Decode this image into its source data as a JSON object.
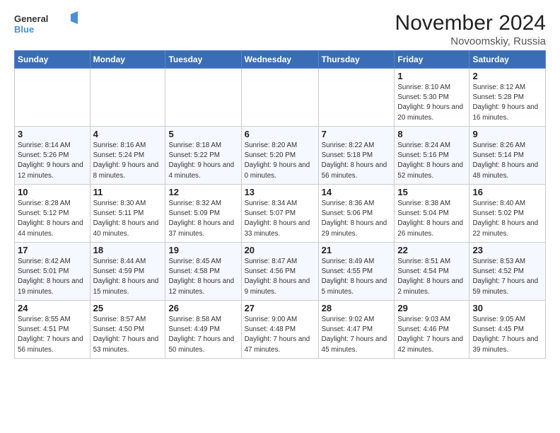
{
  "logo": {
    "text_general": "General",
    "text_blue": "Blue"
  },
  "header": {
    "title": "November 2024",
    "subtitle": "Novoomskiy, Russia"
  },
  "days_of_week": [
    "Sunday",
    "Monday",
    "Tuesday",
    "Wednesday",
    "Thursday",
    "Friday",
    "Saturday"
  ],
  "weeks": [
    [
      null,
      null,
      null,
      null,
      null,
      {
        "day": "1",
        "sunrise": "8:10 AM",
        "sunset": "5:30 PM",
        "daylight": "9 hours and 20 minutes."
      },
      {
        "day": "2",
        "sunrise": "8:12 AM",
        "sunset": "5:28 PM",
        "daylight": "9 hours and 16 minutes."
      }
    ],
    [
      {
        "day": "3",
        "sunrise": "8:14 AM",
        "sunset": "5:26 PM",
        "daylight": "9 hours and 12 minutes."
      },
      {
        "day": "4",
        "sunrise": "8:16 AM",
        "sunset": "5:24 PM",
        "daylight": "9 hours and 8 minutes."
      },
      {
        "day": "5",
        "sunrise": "8:18 AM",
        "sunset": "5:22 PM",
        "daylight": "9 hours and 4 minutes."
      },
      {
        "day": "6",
        "sunrise": "8:20 AM",
        "sunset": "5:20 PM",
        "daylight": "9 hours and 0 minutes."
      },
      {
        "day": "7",
        "sunrise": "8:22 AM",
        "sunset": "5:18 PM",
        "daylight": "8 hours and 56 minutes."
      },
      {
        "day": "8",
        "sunrise": "8:24 AM",
        "sunset": "5:16 PM",
        "daylight": "8 hours and 52 minutes."
      },
      {
        "day": "9",
        "sunrise": "8:26 AM",
        "sunset": "5:14 PM",
        "daylight": "8 hours and 48 minutes."
      }
    ],
    [
      {
        "day": "10",
        "sunrise": "8:28 AM",
        "sunset": "5:12 PM",
        "daylight": "8 hours and 44 minutes."
      },
      {
        "day": "11",
        "sunrise": "8:30 AM",
        "sunset": "5:11 PM",
        "daylight": "8 hours and 40 minutes."
      },
      {
        "day": "12",
        "sunrise": "8:32 AM",
        "sunset": "5:09 PM",
        "daylight": "8 hours and 37 minutes."
      },
      {
        "day": "13",
        "sunrise": "8:34 AM",
        "sunset": "5:07 PM",
        "daylight": "8 hours and 33 minutes."
      },
      {
        "day": "14",
        "sunrise": "8:36 AM",
        "sunset": "5:06 PM",
        "daylight": "8 hours and 29 minutes."
      },
      {
        "day": "15",
        "sunrise": "8:38 AM",
        "sunset": "5:04 PM",
        "daylight": "8 hours and 26 minutes."
      },
      {
        "day": "16",
        "sunrise": "8:40 AM",
        "sunset": "5:02 PM",
        "daylight": "8 hours and 22 minutes."
      }
    ],
    [
      {
        "day": "17",
        "sunrise": "8:42 AM",
        "sunset": "5:01 PM",
        "daylight": "8 hours and 19 minutes."
      },
      {
        "day": "18",
        "sunrise": "8:44 AM",
        "sunset": "4:59 PM",
        "daylight": "8 hours and 15 minutes."
      },
      {
        "day": "19",
        "sunrise": "8:45 AM",
        "sunset": "4:58 PM",
        "daylight": "8 hours and 12 minutes."
      },
      {
        "day": "20",
        "sunrise": "8:47 AM",
        "sunset": "4:56 PM",
        "daylight": "8 hours and 9 minutes."
      },
      {
        "day": "21",
        "sunrise": "8:49 AM",
        "sunset": "4:55 PM",
        "daylight": "8 hours and 5 minutes."
      },
      {
        "day": "22",
        "sunrise": "8:51 AM",
        "sunset": "4:54 PM",
        "daylight": "8 hours and 2 minutes."
      },
      {
        "day": "23",
        "sunrise": "8:53 AM",
        "sunset": "4:52 PM",
        "daylight": "7 hours and 59 minutes."
      }
    ],
    [
      {
        "day": "24",
        "sunrise": "8:55 AM",
        "sunset": "4:51 PM",
        "daylight": "7 hours and 56 minutes."
      },
      {
        "day": "25",
        "sunrise": "8:57 AM",
        "sunset": "4:50 PM",
        "daylight": "7 hours and 53 minutes."
      },
      {
        "day": "26",
        "sunrise": "8:58 AM",
        "sunset": "4:49 PM",
        "daylight": "7 hours and 50 minutes."
      },
      {
        "day": "27",
        "sunrise": "9:00 AM",
        "sunset": "4:48 PM",
        "daylight": "7 hours and 47 minutes."
      },
      {
        "day": "28",
        "sunrise": "9:02 AM",
        "sunset": "4:47 PM",
        "daylight": "7 hours and 45 minutes."
      },
      {
        "day": "29",
        "sunrise": "9:03 AM",
        "sunset": "4:46 PM",
        "daylight": "7 hours and 42 minutes."
      },
      {
        "day": "30",
        "sunrise": "9:05 AM",
        "sunset": "4:45 PM",
        "daylight": "7 hours and 39 minutes."
      }
    ]
  ]
}
